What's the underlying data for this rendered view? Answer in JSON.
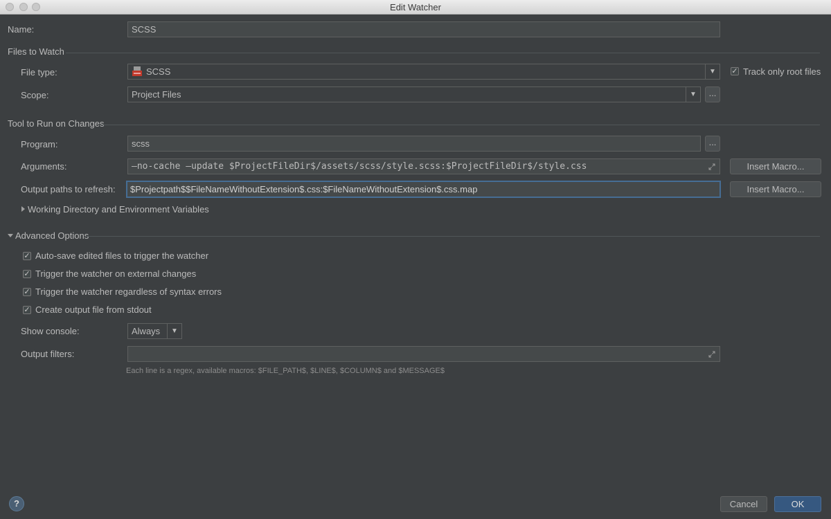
{
  "window": {
    "title": "Edit Watcher"
  },
  "name": {
    "label": "Name:",
    "value": "SCSS"
  },
  "files_to_watch": {
    "heading": "Files to Watch",
    "file_type_label": "File type:",
    "file_type_value": "SCSS",
    "track_root_label": "Track only root files",
    "track_root_checked": true,
    "scope_label": "Scope:",
    "scope_value": "Project Files",
    "scope_browse": "..."
  },
  "tool": {
    "heading": "Tool to Run on Changes",
    "program_label": "Program:",
    "program_value": "scss",
    "program_browse": "...",
    "arguments_label": "Arguments:",
    "arguments_value": "—no-cache —update $ProjectFileDir$/assets/scss/style.scss:$ProjectFileDir$/style.css",
    "insert_macro_1": "Insert Macro...",
    "output_paths_label": "Output paths to refresh:",
    "output_paths_value": "$Projectpath$$FileNameWithoutExtension$.css:$FileNameWithoutExtension$.css.map",
    "insert_macro_2": "Insert Macro...",
    "working_dir_label": "Working Directory and Environment Variables"
  },
  "advanced": {
    "heading": "Advanced Options",
    "options": [
      {
        "label": "Auto-save edited files to trigger the watcher",
        "checked": true
      },
      {
        "label": "Trigger the watcher on external changes",
        "checked": true
      },
      {
        "label": "Trigger the watcher regardless of syntax errors",
        "checked": true
      },
      {
        "label": "Create output file from stdout",
        "checked": true
      }
    ],
    "show_console_label": "Show console:",
    "show_console_value": "Always",
    "output_filters_label": "Output filters:",
    "output_filters_value": "",
    "hint": "Each line is a regex, available macros: $FILE_PATH$, $LINE$, $COLUMN$ and $MESSAGE$"
  },
  "footer": {
    "help": "?",
    "cancel": "Cancel",
    "ok": "OK"
  },
  "colors": {
    "background": "#3c3f41",
    "field": "#45494a",
    "accent": "#365880",
    "focus": "#466d94"
  }
}
